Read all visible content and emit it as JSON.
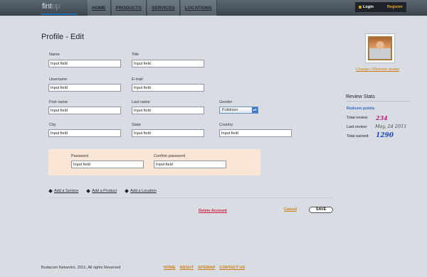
{
  "header": {
    "logo_text": "fintop",
    "logo_text_visible": "fint",
    "logo_text_faded": "op",
    "nav": [
      "HOME",
      "PRODUCTS",
      "SERVICES",
      "LOCATIONS"
    ],
    "login": "Login",
    "register": "Register",
    "accent": "#e7a52b"
  },
  "main": {
    "title": "Profile - Edit",
    "fields": {
      "name": {
        "label": "Name",
        "value": "Input field"
      },
      "title": {
        "label": "Title",
        "value": "Input field"
      },
      "username": {
        "label": "Username",
        "value": "Input field"
      },
      "email": {
        "label": "E-mail",
        "value": "Input field"
      },
      "first_name": {
        "label": "First name",
        "value": "Input field"
      },
      "last_name": {
        "label": "Last name",
        "value": "Input field"
      },
      "gender": {
        "label": "Gender",
        "value": "Pulldown"
      },
      "city": {
        "label": "City",
        "value": "Input field"
      },
      "state": {
        "label": "State",
        "value": "Input field"
      },
      "country": {
        "label": "Country",
        "value": "Input field"
      },
      "password": {
        "label": "Password",
        "value": "Input field"
      },
      "confirm_password": {
        "label": "Confirm password",
        "value": "Input field"
      }
    },
    "add_links": [
      "Add a Service",
      "Add a Product",
      "Add a Location"
    ],
    "delete_account": "Delete Account",
    "cancel": "Cancel",
    "save": "SAVE"
  },
  "sidebar": {
    "change_avatar": "Change / Remove avatar",
    "review_title": "Review Stats",
    "redeem": "Redeem points",
    "stats": [
      {
        "label": "Total review:",
        "value": "234",
        "color": "#c2187a"
      },
      {
        "label": "Last review:",
        "value": "May, 24 2011",
        "color": "#444444"
      },
      {
        "label": "Total earned:",
        "value": "1290",
        "color": "#1f48c2"
      }
    ]
  },
  "footer": {
    "copyright": "Budacom Networks, 2011, All rights Reserved",
    "links": [
      "HOME",
      "ABOUT",
      "SITEMAP",
      "CONTACT US"
    ]
  }
}
